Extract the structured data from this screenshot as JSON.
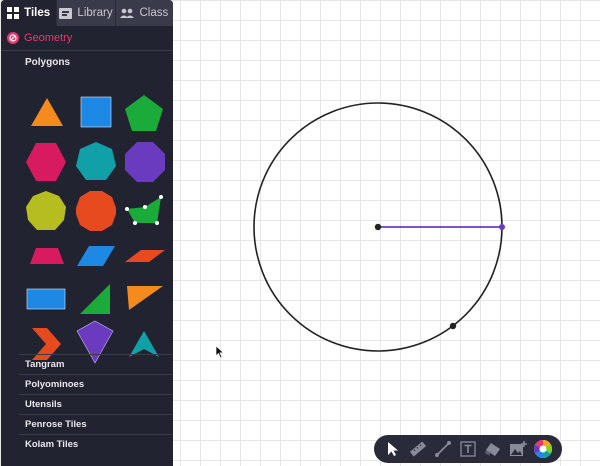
{
  "tabs": [
    {
      "label": "Tiles",
      "icon": "grid-icon",
      "active": true
    },
    {
      "label": "Library",
      "icon": "library-icon",
      "active": false
    },
    {
      "label": "Class",
      "icon": "people-icon",
      "active": false
    }
  ],
  "category": {
    "label": "Geometry",
    "icon": "geometry-icon",
    "color": "#e8386e"
  },
  "subsection": {
    "title": "Polygons"
  },
  "shapes": [
    {
      "name": "triangle",
      "color": "#f58a1f"
    },
    {
      "name": "square",
      "color": "#1e88e5"
    },
    {
      "name": "pentagon",
      "color": "#1aab3a"
    },
    {
      "name": "hexagon",
      "color": "#d81b60"
    },
    {
      "name": "heptagon",
      "color": "#12a0a8"
    },
    {
      "name": "octagon",
      "color": "#6a3bbf"
    },
    {
      "name": "nonagon",
      "color": "#b5bd1f"
    },
    {
      "name": "decagon",
      "color": "#e84a1f"
    },
    {
      "name": "custom-polygon",
      "color": "#1aab3a"
    },
    {
      "name": "trapezoid",
      "color": "#d81b60"
    },
    {
      "name": "parallelogram",
      "color": "#1e88e5"
    },
    {
      "name": "thin-rhombus",
      "color": "#e84a1f"
    },
    {
      "name": "rectangle",
      "color": "#1e88e5"
    },
    {
      "name": "right-triangle",
      "color": "#1aab3a"
    },
    {
      "name": "obtuse-triangle",
      "color": "#f58a1f"
    },
    {
      "name": "chevron",
      "color": "#e84a1f"
    },
    {
      "name": "kite",
      "color": "#6a3bbf"
    },
    {
      "name": "arrowhead",
      "color": "#12a0a8"
    }
  ],
  "sections": [
    {
      "label": "Tangram"
    },
    {
      "label": "Polyominoes"
    },
    {
      "label": "Utensils"
    },
    {
      "label": "Penrose Tiles"
    },
    {
      "label": "Kolam Tiles"
    }
  ],
  "canvas": {
    "circle_stroke": "#222222",
    "radius_color": "#6a3bbf"
  },
  "toolbar": {
    "tools": [
      "select-icon",
      "ruler-icon",
      "line-icon",
      "text-icon",
      "eraser-icon",
      "add-image-icon",
      "color-wheel-icon"
    ]
  }
}
